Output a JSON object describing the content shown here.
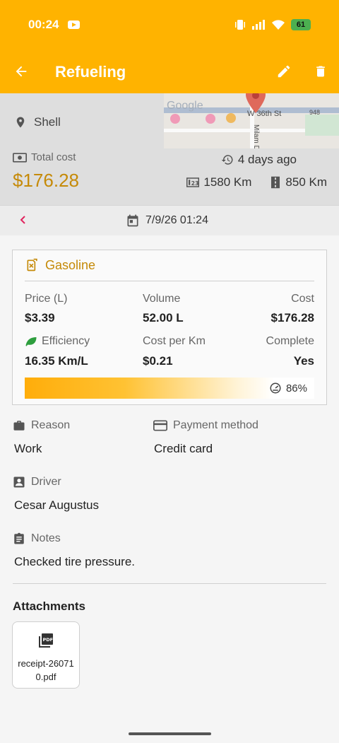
{
  "status": {
    "time": "00:24",
    "battery": "61"
  },
  "appbar": {
    "title": "Refueling"
  },
  "header": {
    "place": "Shell",
    "map_labels": [
      "Google",
      "W 36th St",
      "948",
      "Milam D"
    ],
    "total_cost_label": "Total cost",
    "total_cost": "$176.28",
    "time_ago": "4 days ago",
    "odometer": "1580 Km",
    "distance": "850 Km"
  },
  "datebar": {
    "date": "7/9/26 01:24"
  },
  "fuel": {
    "type": "Gasoline",
    "price_label": "Price (L)",
    "price": "$3.39",
    "volume_label": "Volume",
    "volume": "52.00 L",
    "cost_label": "Cost",
    "cost": "$176.28",
    "efficiency_label": "Efficiency",
    "efficiency": "16.35 Km/L",
    "cost_per_km_label": "Cost per Km",
    "cost_per_km": "$0.21",
    "complete_label": "Complete",
    "complete": "Yes",
    "level_pct": 86,
    "level_label": "86%"
  },
  "details": {
    "reason_label": "Reason",
    "reason": "Work",
    "payment_label": "Payment method",
    "payment": "Credit card",
    "driver_label": "Driver",
    "driver": "Cesar Augustus",
    "notes_label": "Notes",
    "notes": "Checked tire pressure."
  },
  "attachments": {
    "title": "Attachments",
    "files": [
      {
        "name": "receipt-260710.pdf"
      }
    ]
  },
  "colors": {
    "accent": "#ffb300",
    "cost": "#c58a08",
    "leaf": "#2e9e3e",
    "nav_back": "#e0245e"
  }
}
